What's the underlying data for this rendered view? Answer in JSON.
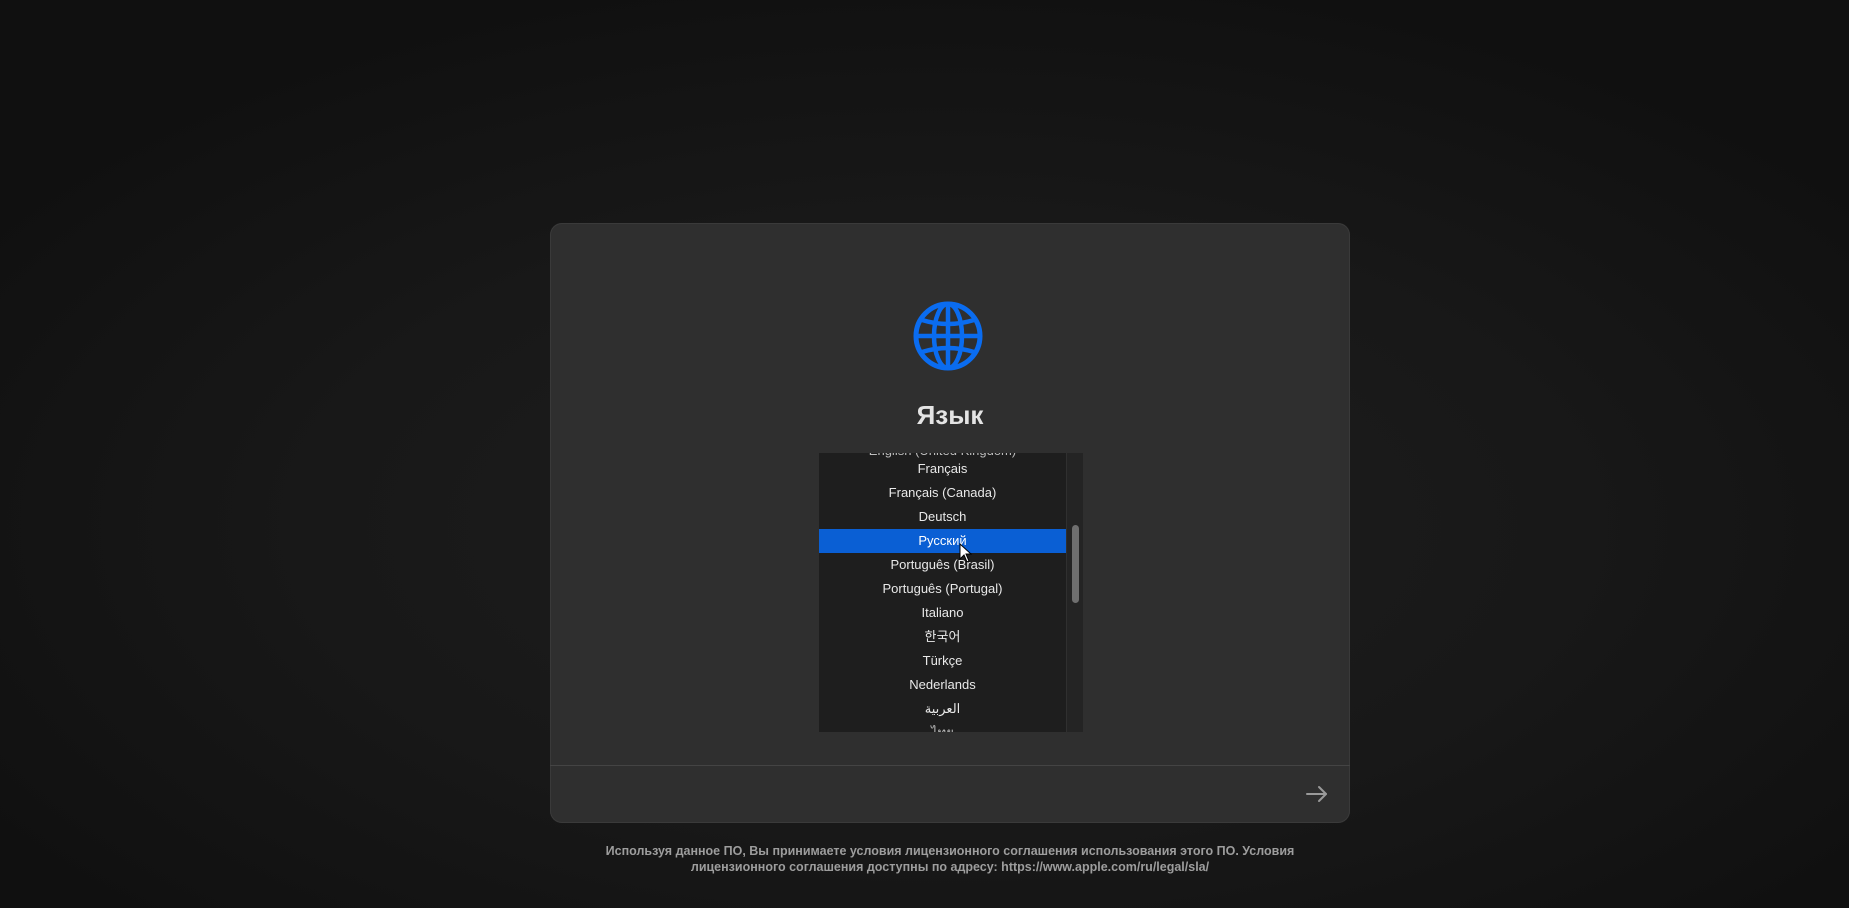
{
  "dialog": {
    "title": "Язык",
    "icon": "globe-icon",
    "accent_color": "#0a6cf0"
  },
  "language_list": {
    "items": [
      {
        "label": "English (United Kingdom)",
        "state": "partial"
      },
      {
        "label": "Français"
      },
      {
        "label": "Français (Canada)"
      },
      {
        "label": "Deutsch"
      },
      {
        "label": "Русский",
        "state": "selected"
      },
      {
        "label": "Português (Brasil)"
      },
      {
        "label": "Português (Portugal)"
      },
      {
        "label": "Italiano"
      },
      {
        "label": "한국어"
      },
      {
        "label": "Türkçe"
      },
      {
        "label": "Nederlands"
      },
      {
        "label": "العربية"
      },
      {
        "label": "ไทย",
        "state": "partial"
      }
    ],
    "selected_label": "Русский",
    "selected_color": "#0a5fd4"
  },
  "next_button": {
    "icon": "arrow-right-icon"
  },
  "footer": {
    "line1": "Используя данное ПО, Вы принимаете условия лицензионного соглашения использования этого ПО. Условия",
    "line2": "лицензионного соглашения доступны по адресу: https://www.apple.com/ru/legal/sla/"
  }
}
